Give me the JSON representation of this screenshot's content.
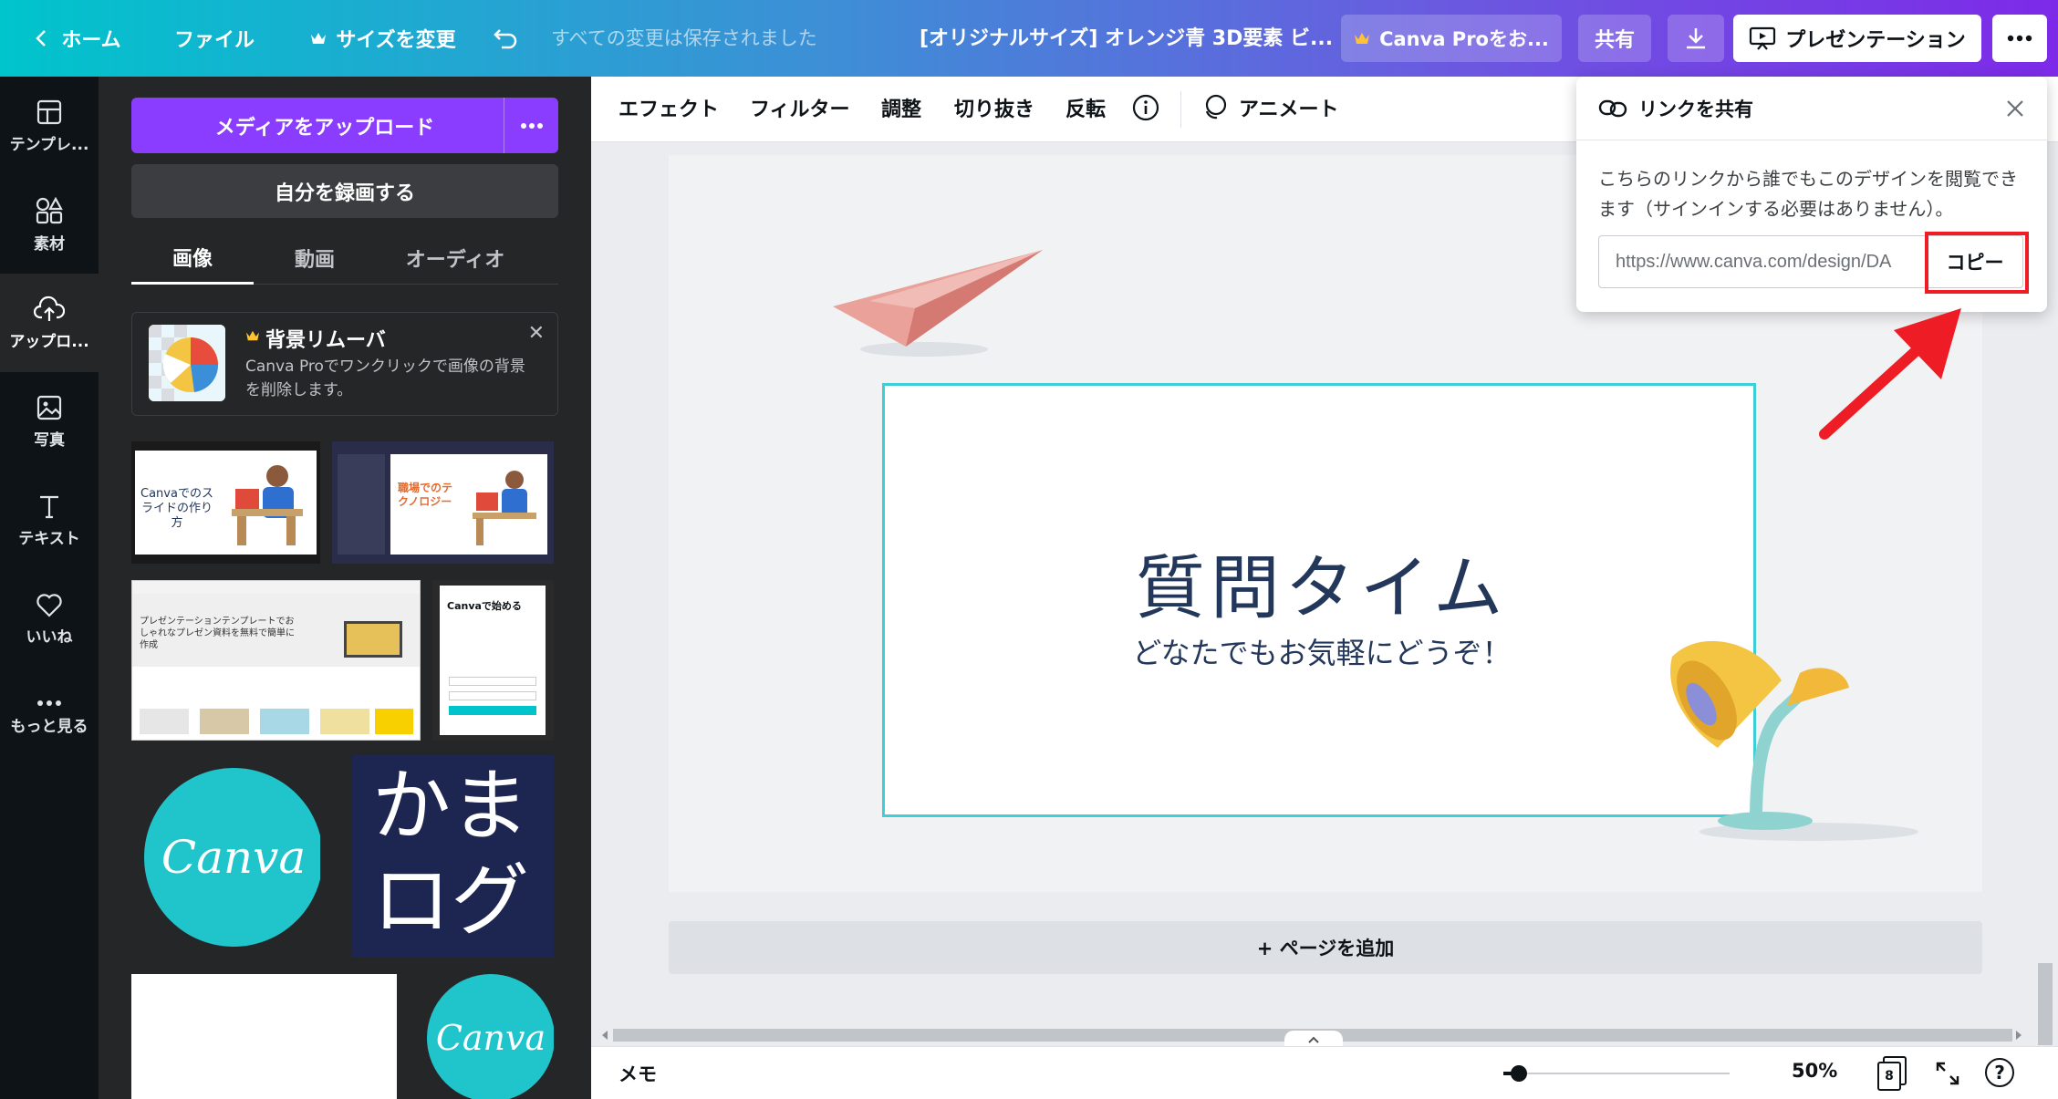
{
  "header": {
    "home": "ホーム",
    "file": "ファイル",
    "resize": "サイズを変更",
    "save_status": "すべての変更は保存されました",
    "doc_title": "[オリジナルサイズ] オレンジ青 3D要素 ビ...",
    "pro_button": "Canva Proをお...",
    "share": "共有",
    "present": "プレゼンテーション",
    "colors": {
      "pro_button_bg": "#7f6fe0",
      "present_bg": "#ffffff"
    }
  },
  "rail": {
    "items": [
      {
        "label": "テンプレ...",
        "icon": "layout-icon"
      },
      {
        "label": "素材",
        "icon": "shapes-icon"
      },
      {
        "label": "アップロ...",
        "icon": "cloud-upload-icon"
      },
      {
        "label": "写真",
        "icon": "image-icon"
      },
      {
        "label": "テキスト",
        "icon": "text-icon"
      },
      {
        "label": "いいね",
        "icon": "heart-icon"
      },
      {
        "label": "もっと見る",
        "icon": "more-dots-icon"
      }
    ],
    "active_index": 2
  },
  "panel": {
    "upload_button": "メディアをアップロード",
    "record_button": "自分を録画する",
    "tabs": [
      "画像",
      "動画",
      "オーディオ"
    ],
    "active_tab": 0,
    "bg_remover": {
      "title": "背景リムーバ",
      "desc": "Canva Proでワンクリックで画像の背景を削除します。"
    },
    "thumbs": {
      "t1_text": "Canvaでのスライドの作り方",
      "t2_text": "職場でのテクノロジー",
      "t3_text": "プレゼンテーションテンプレートでおしゃれなプレゼン資料を無料で簡単に作成",
      "t4_text": "Canvaで始める",
      "canva_logo": "Canva",
      "kama_line1": "かま",
      "kama_line2": "ログ"
    }
  },
  "toolbar": {
    "items": [
      "エフェクト",
      "フィルター",
      "調整",
      "切り抜き",
      "反転"
    ],
    "animate": "アニメート"
  },
  "slide": {
    "title": "質問タイム",
    "subtitle": "どなたでもお気軽にどうぞ！"
  },
  "add_page": "+ ページを追加",
  "bottom": {
    "notes": "メモ",
    "zoom": "50%",
    "page_count": "8"
  },
  "share_popup": {
    "title": "リンクを共有",
    "desc": "こちらのリンクから誰でもこのデザインを閲覧できます（サインインする必要はありません）。",
    "link": "https://www.canva.com/design/DA",
    "copy": "コピー"
  }
}
